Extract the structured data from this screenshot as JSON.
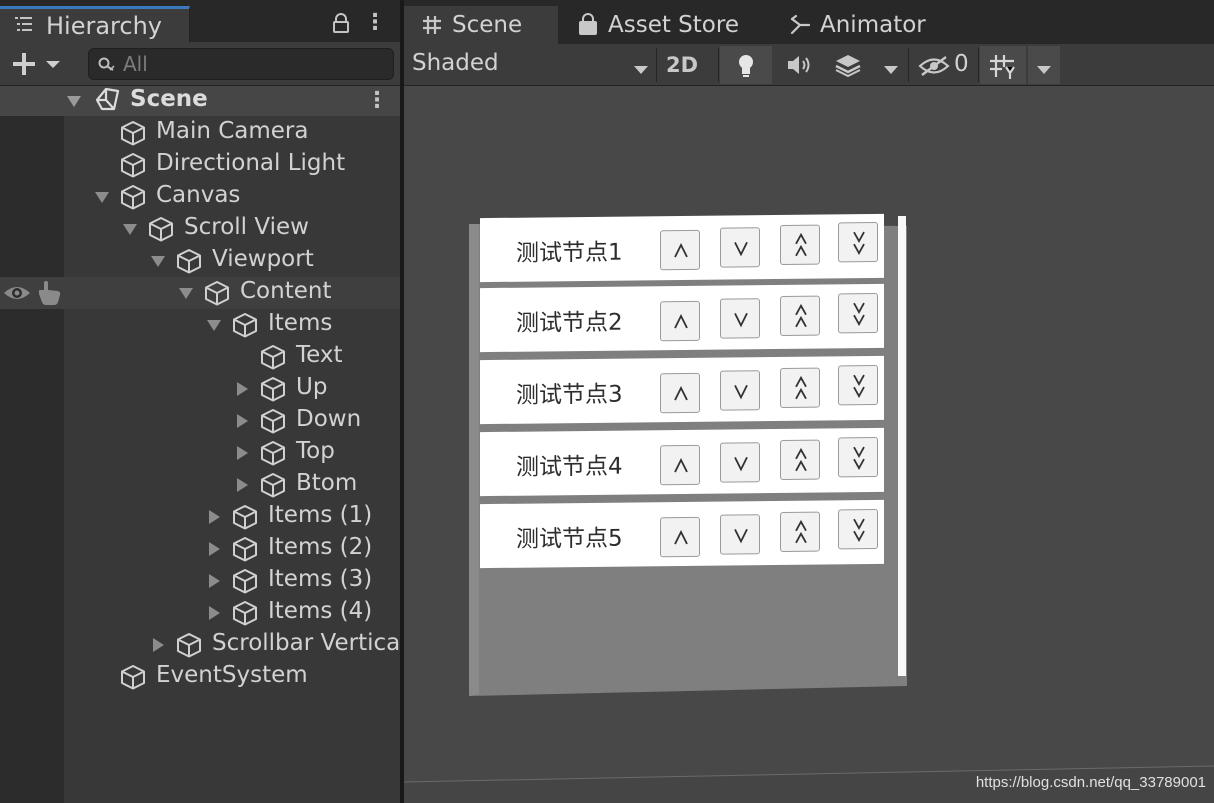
{
  "hierarchy": {
    "tab_label": "Hierarchy",
    "search_placeholder": "All",
    "scene_name": "Scene",
    "nodes": [
      {
        "label": "Main Camera"
      },
      {
        "label": "Directional Light"
      },
      {
        "label": "Canvas"
      },
      {
        "label": "Scroll View"
      },
      {
        "label": "Viewport"
      },
      {
        "label": "Content"
      },
      {
        "label": "Items"
      },
      {
        "label": "Text"
      },
      {
        "label": "Up"
      },
      {
        "label": "Down"
      },
      {
        "label": "Top"
      },
      {
        "label": "Btom"
      },
      {
        "label": "Items (1)"
      },
      {
        "label": "Items (2)"
      },
      {
        "label": "Items (3)"
      },
      {
        "label": "Items (4)"
      },
      {
        "label": "Scrollbar Vertica"
      },
      {
        "label": "EventSystem"
      }
    ]
  },
  "scene_view": {
    "tabs": [
      {
        "label": "Scene"
      },
      {
        "label": "Asset Store"
      },
      {
        "label": "Animator"
      }
    ],
    "shading_mode": "Shaded",
    "mode_2d_label": "2D",
    "hidden_count": "0",
    "items": [
      {
        "label": "测试节点1"
      },
      {
        "label": "测试节点2"
      },
      {
        "label": "测试节点3"
      },
      {
        "label": "测试节点4"
      },
      {
        "label": "测试节点5"
      }
    ]
  },
  "watermark": "https://blog.csdn.net/qq_33789001",
  "colors": {
    "accent": "#3a79bb",
    "panel": "#383838",
    "scene_bg": "#484848"
  }
}
